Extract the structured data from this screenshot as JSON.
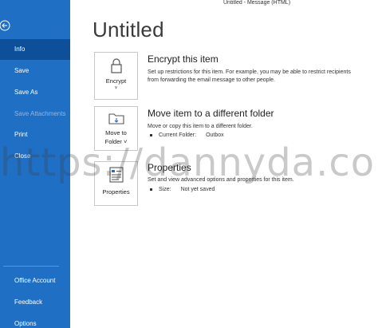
{
  "window": {
    "title": "Untitled  -  Message (HTML)"
  },
  "sidebar": {
    "back_icon": "back-arrow-icon",
    "items": [
      {
        "label": "Info"
      },
      {
        "label": "Save"
      },
      {
        "label": "Save As"
      },
      {
        "label": "Save Attachments"
      },
      {
        "label": "Print"
      },
      {
        "label": "Close"
      }
    ],
    "bottom_items": [
      {
        "label": "Office Account"
      },
      {
        "label": "Feedback"
      },
      {
        "label": "Options"
      }
    ]
  },
  "page": {
    "title": "Untitled"
  },
  "encrypt": {
    "button_label": "Encrypt",
    "icon": "padlock-icon",
    "title": "Encrypt this item",
    "desc_line1": "Set up restrictions for this item. For example, you may be able to restrict recipients",
    "desc_line2": "from forwarding the email message to other people."
  },
  "move": {
    "button_label_line1": "Move to",
    "button_label_line2": "Folder ˅",
    "icon": "folder-icon",
    "title": "Move item to a different folder",
    "desc": "Move or copy this item to a different folder.",
    "current_folder_label": "Current Folder:",
    "current_folder_value": "Outbox"
  },
  "properties": {
    "button_label": "Properties",
    "icon": "properties-icon",
    "title": "Properties",
    "desc": "Set and view advanced options and properties for this item.",
    "size_label": "Size:",
    "size_value": "Not yet saved"
  },
  "watermark": {
    "text": "https://dannyda.com"
  },
  "colors": {
    "sidebar": "#1f6fc5",
    "sidebar_active": "#0e4f9a"
  }
}
